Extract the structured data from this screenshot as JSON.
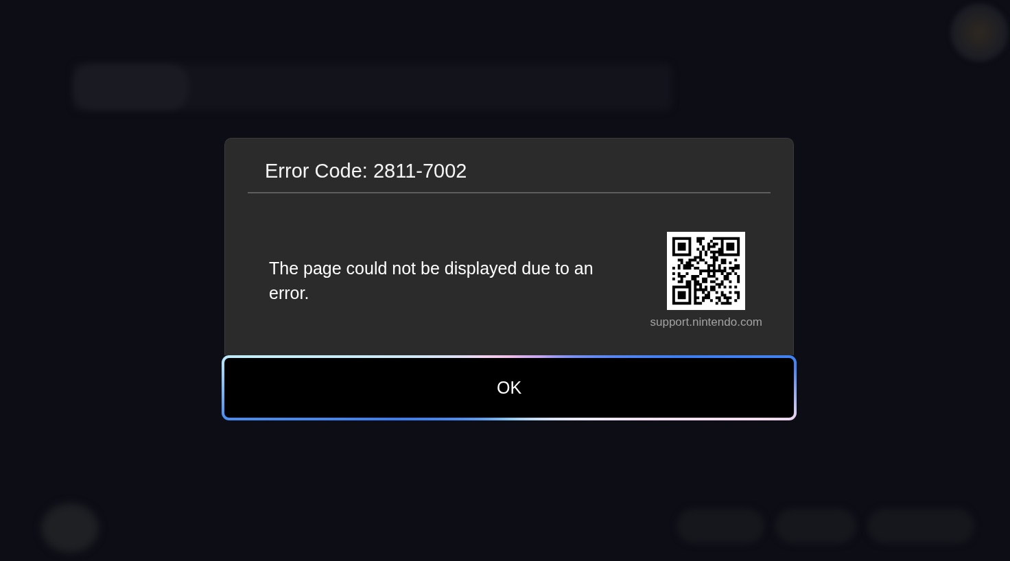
{
  "dialog": {
    "title": "Error Code: 2811-7002",
    "message": "The page could not be displayed due to an error.",
    "qr_caption": "support.nintendo.com",
    "button": {
      "label": "OK",
      "focused": true
    }
  }
}
